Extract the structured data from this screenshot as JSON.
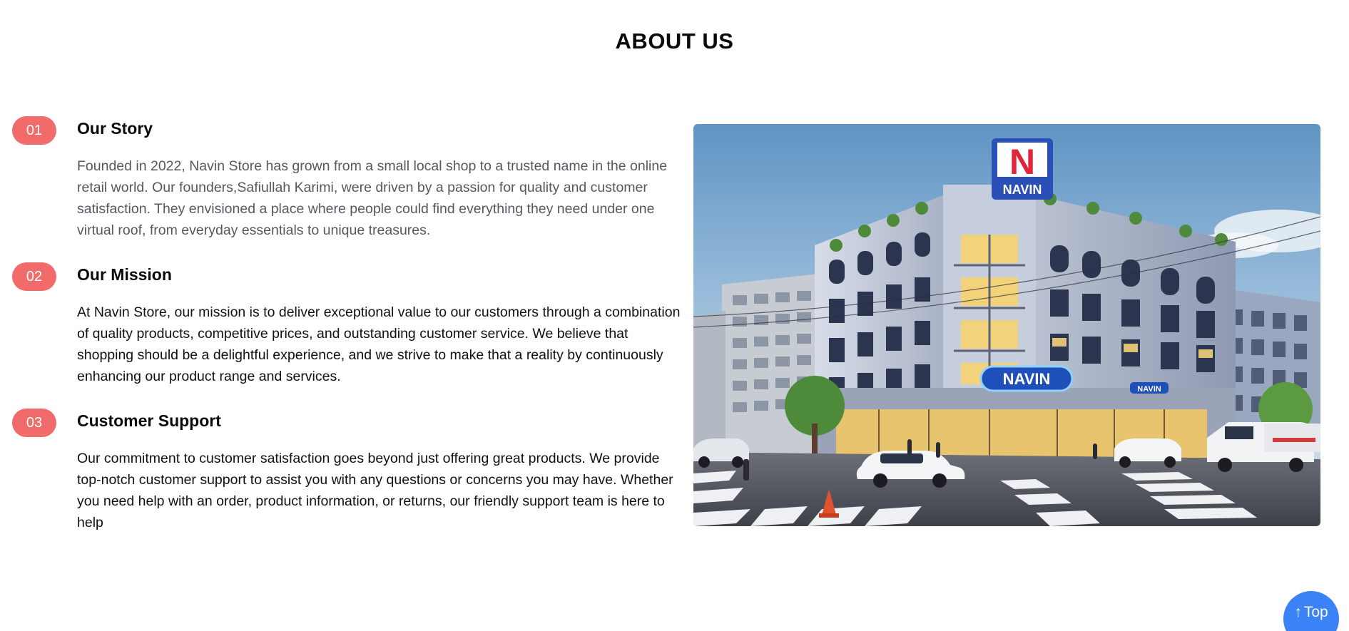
{
  "page": {
    "title": "ABOUT US"
  },
  "sections": [
    {
      "number": "01",
      "title": "Our Story",
      "body": "Founded in 2022, Navin Store has grown from a small local shop to a trusted name in the online retail world. Our founders,Safiullah Karimi, were driven by a passion for quality and customer satisfaction. They envisioned a place where people could find everything they need under one virtual roof, from everyday essentials to unique treasures."
    },
    {
      "number": "02",
      "title": "Our Mission",
      "body": "At Navin Store, our mission is to deliver exceptional value to our customers through a combination of quality products, competitive prices, and outstanding customer service. We believe that shopping should be a delightful experience, and we strive to make that a reality by continuously enhancing our product range and services."
    },
    {
      "number": "03",
      "title": "Customer Support",
      "body": "Our commitment to customer satisfaction goes beyond just offering great products. We provide top-notch customer support to assist you with any questions or concerns you may have. Whether you need help with an order, product information, or returns, our friendly support team is here to help"
    }
  ],
  "hero": {
    "logo_letter": "N",
    "logo_text": "NAVIN",
    "sign_text": "NAVIN",
    "small_sign": "NAVIN"
  },
  "back_to_top": {
    "arrow": "↑",
    "label": "Top"
  },
  "colors": {
    "badge": "#f26b6b",
    "top_button": "#3b82f6",
    "muted_text": "#55595e"
  }
}
